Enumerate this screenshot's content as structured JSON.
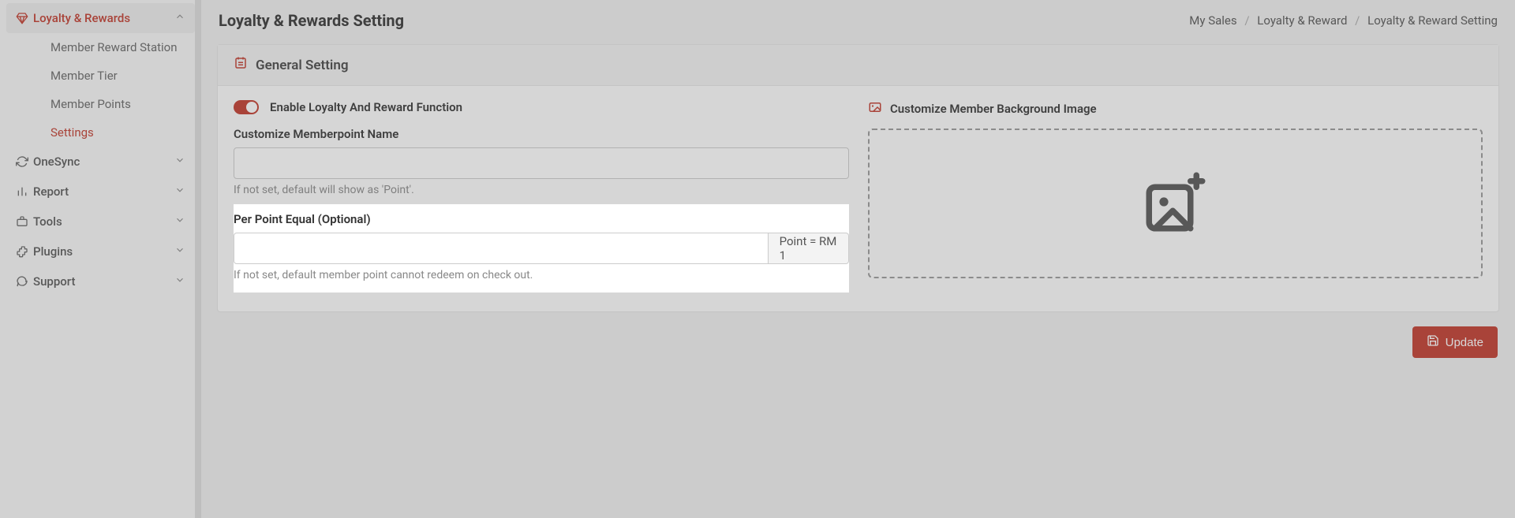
{
  "sidebar": {
    "loyalty": {
      "label": "Loyalty & Rewards"
    },
    "sub": {
      "reward_station": "Member Reward Station",
      "member_tier": "Member Tier",
      "member_points": "Member Points",
      "settings": "Settings"
    },
    "onesync": "OneSync",
    "report": "Report",
    "tools": "Tools",
    "plugins": "Plugins",
    "support": "Support"
  },
  "header": {
    "title": "Loyalty & Rewards Setting",
    "breadcrumb": {
      "a": "My Sales",
      "b": "Loyalty & Reward",
      "c": "Loyalty & Reward Setting"
    }
  },
  "card": {
    "title": "General Setting",
    "toggle_label": "Enable Loyalty And Reward Function",
    "memberpoint": {
      "label": "Customize Memberpoint Name",
      "value": "",
      "help": "If not set, default will show as 'Point'."
    },
    "per_point": {
      "label": "Per Point Equal (Optional)",
      "value": "",
      "addon": "Point = RM 1",
      "help": "If not set, default member point cannot redeem on check out."
    },
    "bg_image_label": "Customize Member Background Image"
  },
  "footer": {
    "update": "Update"
  }
}
